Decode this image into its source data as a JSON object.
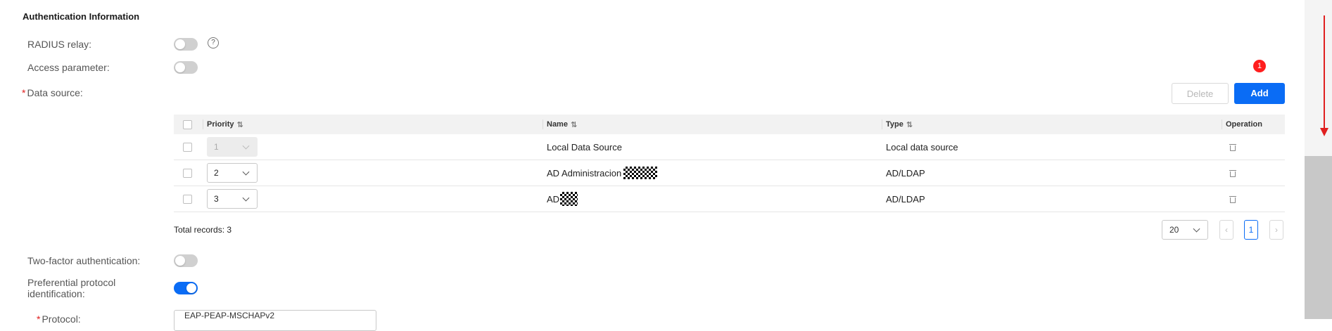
{
  "section": {
    "title": "Authentication Information"
  },
  "fields": {
    "radius_relay": {
      "label": "RADIUS relay:",
      "on": false,
      "help": "?"
    },
    "access_parameter": {
      "label": "Access parameter:",
      "on": false
    },
    "data_source": {
      "label": "Data source:",
      "required_mark": "*"
    },
    "two_factor": {
      "label": "Two-factor authentication:",
      "on": false
    },
    "preferential_protocol": {
      "label_line1": "Preferential protocol",
      "label_line2": "identification:",
      "on": true
    },
    "protocol": {
      "label": "Protocol:",
      "required_mark": "*",
      "value": "EAP-PEAP-MSCHAPv2"
    }
  },
  "toolbar": {
    "delete_label": "Delete",
    "add_label": "Add",
    "badge": "1"
  },
  "table": {
    "columns": {
      "priority": "Priority",
      "name": "Name",
      "type": "Type",
      "operation": "Operation"
    },
    "sort_glyph": "⇅",
    "rows": [
      {
        "priority": "1",
        "name": "Local Data Source",
        "type": "Local data source",
        "disabled": true
      },
      {
        "priority": "2",
        "name": "AD Administracion",
        "type": "AD/LDAP",
        "disabled": false
      },
      {
        "priority": "3",
        "name": "AD",
        "type": "AD/LDAP",
        "disabled": false
      }
    ]
  },
  "pagination": {
    "total": "Total records: 3",
    "page_size": "20",
    "current_page": "1",
    "prev": "‹",
    "next": "›"
  },
  "colors": {
    "accent": "#0a6cf5",
    "annotation": "#e02020"
  }
}
